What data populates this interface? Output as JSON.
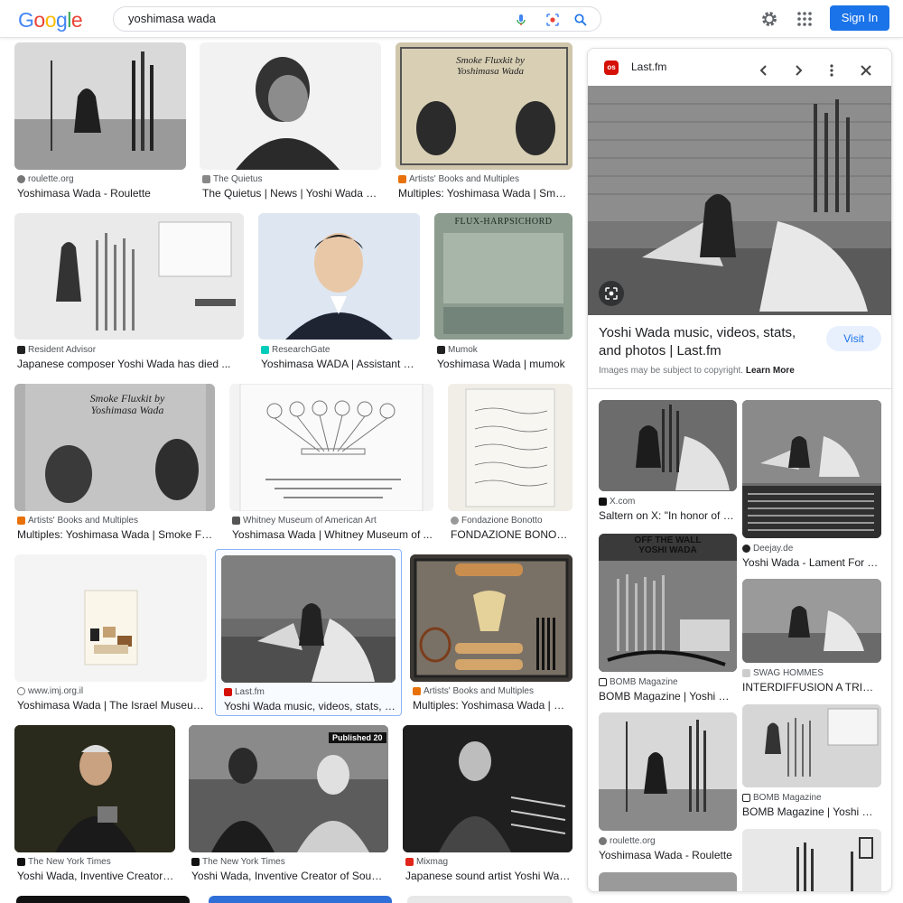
{
  "header": {
    "logo": "Google",
    "query": "yoshimasa wada",
    "signin_label": "Sign In"
  },
  "results": [
    {
      "source": "roulette.org",
      "title": "Yoshimasa Wada - Roulette",
      "icon": "roulette-icon"
    },
    {
      "source": "The Quietus",
      "title": "The Quietus | News | Yoshi Wada Ha...",
      "icon": "quietus-icon"
    },
    {
      "source": "Artists' Books and Multiples",
      "title": "Multiples: Yoshimasa Wada | Smoke...",
      "icon": "artists-books-icon"
    },
    {
      "source": "Resident Advisor",
      "title": "Japanese composer Yoshi Wada has died ...",
      "icon": "resident-advisor-icon"
    },
    {
      "source": "ResearchGate",
      "title": "Yoshimasa WADA | Assistant Pro...",
      "icon": "researchgate-icon"
    },
    {
      "source": "Mumok",
      "title": "Yoshimasa Wada | mumok",
      "icon": "mumok-icon"
    },
    {
      "source": "Artists' Books and Multiples",
      "title": "Multiples: Yoshimasa Wada | Smoke Flux...",
      "icon": "artists-books-icon"
    },
    {
      "source": "Whitney Museum of American Art",
      "title": "Yoshimasa Wada | Whitney Museum of ...",
      "icon": "whitney-icon"
    },
    {
      "source": "Fondazione Bonotto",
      "title": "FONDAZIONE BONOTTO ...",
      "icon": "bonotto-icon"
    },
    {
      "source": "www.imj.org.il",
      "title": "Yoshimasa Wada | The Israel Museum ...",
      "icon": "globe-icon"
    },
    {
      "source": "Last.fm",
      "title": "Yoshi Wada music, videos, stats, an...",
      "icon": "lastfm-icon"
    },
    {
      "source": "Artists' Books and Multiples",
      "title": "Multiples: Yoshimasa Wada | Sm...",
      "icon": "artists-books-icon"
    },
    {
      "source": "The New York Times",
      "title": "Yoshi Wada, Inventive Creator of...",
      "icon": "nyt-icon"
    },
    {
      "source": "The New York Times",
      "title": "Yoshi Wada, Inventive Creator of Sound ...",
      "icon": "nyt-icon"
    },
    {
      "source": "Mixmag",
      "title": "Japanese sound artist Yoshi Wada...",
      "icon": "mixmag-icon"
    }
  ],
  "image_captions": {
    "smoke_fluxkit": "Smoke Fluxkit by Yoshimasa Wada",
    "flux_harpsichord": "FLUX-HARPSICHORD",
    "published_badge": "Published 20",
    "off_the_wall": "OFF THE WALL YOSHI WADA"
  },
  "panel": {
    "source": "Last.fm",
    "title": "Yoshi Wada music, videos, stats, and photos | Last.fm",
    "visit_label": "Visit",
    "copyright": "Images may be subject to copyright.",
    "learn_more": "Learn More",
    "related": [
      {
        "source": "X.com",
        "title": "Saltern on X: \"In honor of the...",
        "icon": "x-icon"
      },
      {
        "source": "Deejay.de",
        "title": "Yoshi Wada - Lament For Th...",
        "icon": "deejay-icon"
      },
      {
        "source": "BOMB Magazine",
        "title": "BOMB Magazine | Yoshi Wada",
        "icon": "bomb-icon"
      },
      {
        "source": "SWAG HOMMES",
        "title": "INTERDIFFUSION A TRIBUTE...",
        "icon": "swag-icon"
      },
      {
        "source": "roulette.org",
        "title": "Yoshimasa Wada - Roulette",
        "icon": "roulette-icon"
      },
      {
        "source": "BOMB Magazine",
        "title": "BOMB Magazine | Yoshi Wada",
        "icon": "bomb-icon"
      }
    ]
  },
  "colors": {
    "accent": "#1a73e8",
    "selected_border": "#8ab4f8",
    "lastfm_red": "#d51007"
  }
}
